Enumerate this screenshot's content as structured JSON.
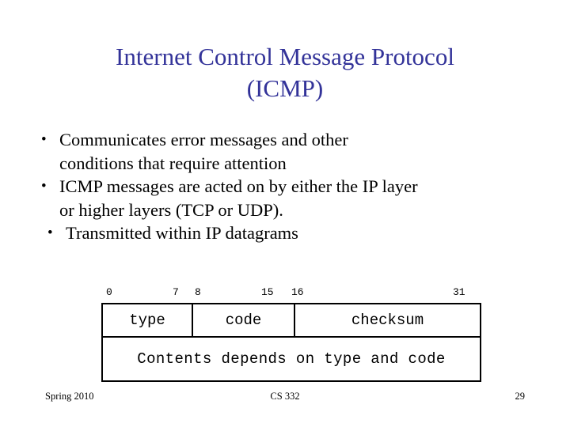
{
  "slide": {
    "title_lines": [
      "Internet Control Message Protocol",
      "(ICMP)"
    ],
    "title_color": "#333399",
    "background_color": "#ffffff",
    "bullets": [
      {
        "marker": "•",
        "lines": [
          "Communicates error messages and other",
          "conditions that require attention"
        ]
      },
      {
        "marker": "•",
        "lines": [
          "ICMP messages are acted on by either the IP layer",
          "or higher layers (TCP or UDP)."
        ]
      },
      {
        "marker": "•",
        "lines": [
          "Transmitted within IP datagrams"
        ]
      }
    ],
    "packet_diagram": {
      "bit_labels": {
        "b0": "0",
        "b7": "7",
        "b8": "8",
        "b15": "15",
        "b16": "16",
        "b31": "31"
      },
      "row1": {
        "type": "type",
        "code": "code",
        "checksum": "checksum"
      },
      "row2": {
        "contents": "Contents depends on type and code"
      }
    },
    "footer": {
      "left": "Spring 2010",
      "center": "CS 332",
      "right": "29"
    }
  }
}
